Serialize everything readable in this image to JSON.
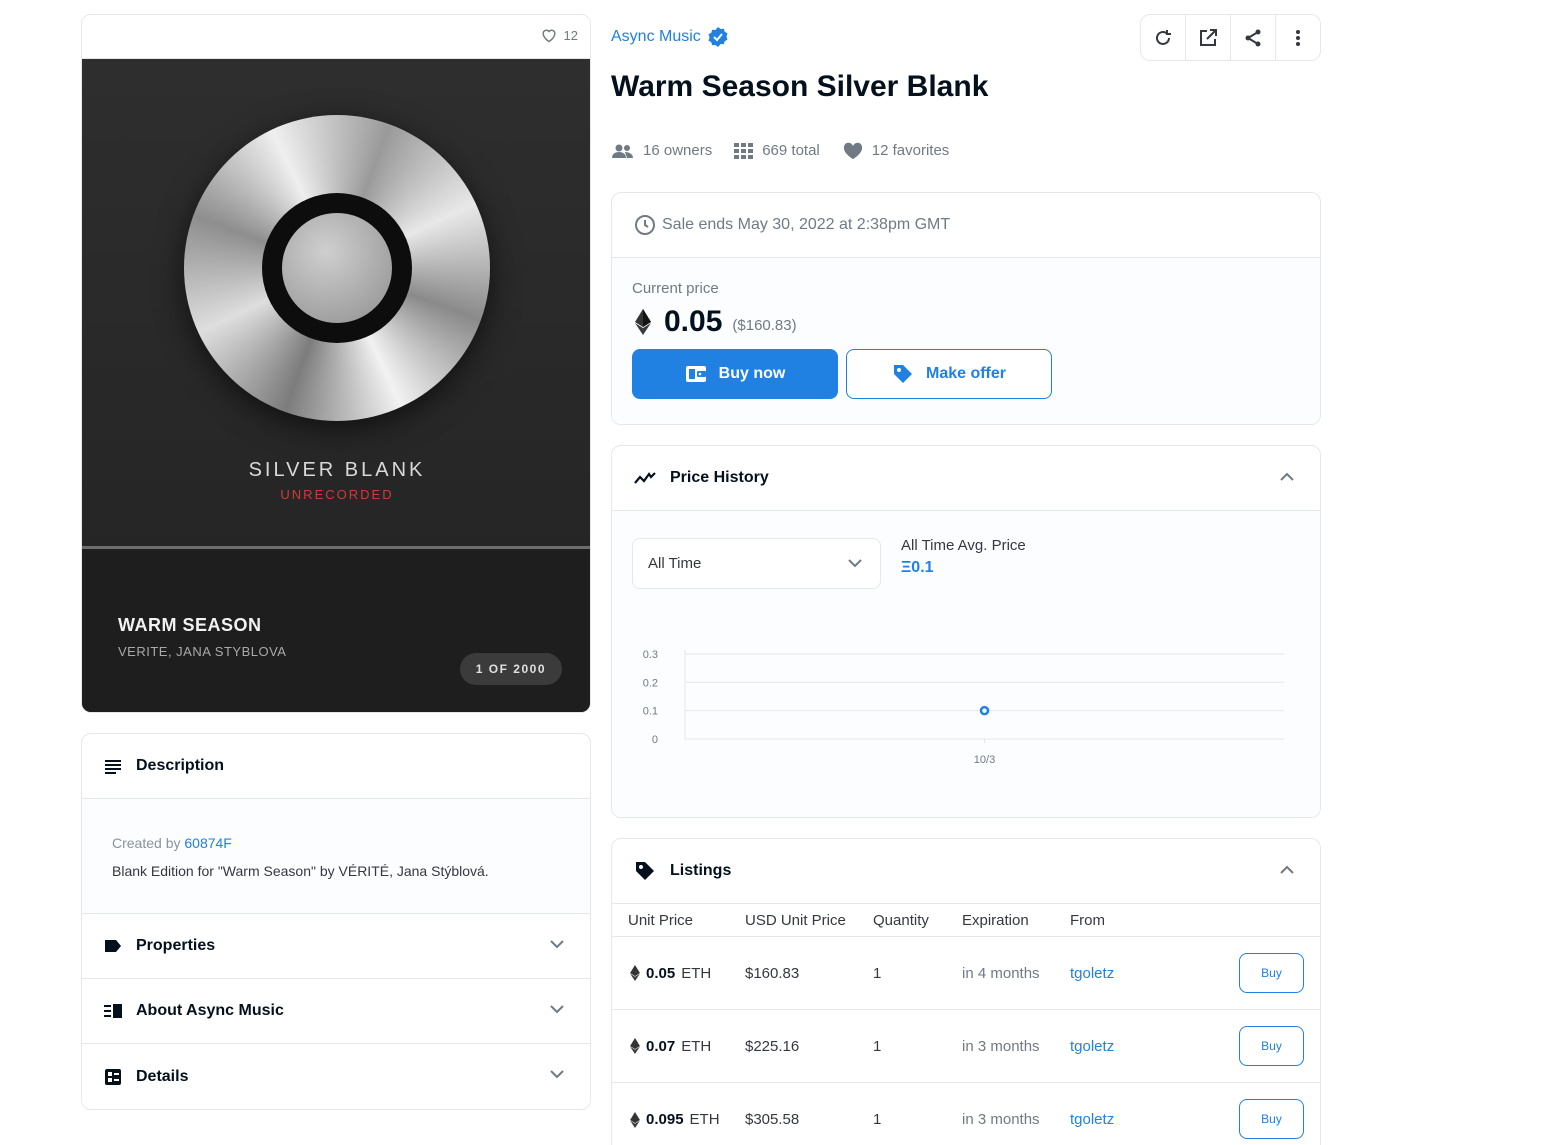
{
  "media": {
    "favorites_count": "12",
    "art_title": "SILVER BLANK",
    "art_subtitle": "UNRECORDED",
    "art_name": "WARM SEASON",
    "art_artists": "VERITE, JANA STYBLOVA",
    "edition": "1 OF 2000"
  },
  "description": {
    "heading": "Description",
    "created_by_label": "Created by",
    "creator": "60874F",
    "text": "Blank Edition for \"Warm Season\" by VÉRITÉ, Jana Stýblová.",
    "sections": [
      {
        "label": "Properties",
        "icon": "tag-icon"
      },
      {
        "label": "About Async Music",
        "icon": "about-icon"
      },
      {
        "label": "Details",
        "icon": "details-icon"
      }
    ]
  },
  "header": {
    "collection": "Async Music",
    "title": "Warm Season Silver Blank",
    "stats": {
      "owners": "16 owners",
      "total": "669 total",
      "favorites": "12 favorites"
    }
  },
  "sale": {
    "ends": "Sale ends May 30, 2022 at 2:38pm GMT",
    "price_label": "Current price",
    "price": "0.05",
    "price_usd": "($160.83)",
    "buy_now": "Buy now",
    "make_offer": "Make offer"
  },
  "price_history": {
    "heading": "Price History",
    "range": "All Time",
    "avg_label": "All Time Avg. Price",
    "avg_value": "Ξ0.1"
  },
  "chart_data": {
    "type": "scatter",
    "x": [
      "10/3"
    ],
    "values": [
      0.1
    ],
    "yticks": [
      "0.3",
      "0.2",
      "0.1",
      "0"
    ],
    "ylim": [
      0,
      0.3
    ],
    "color": "#2081e2"
  },
  "listings": {
    "heading": "Listings",
    "columns": [
      "Unit Price",
      "USD Unit Price",
      "Quantity",
      "Expiration",
      "From"
    ],
    "rows": [
      {
        "price": "0.05",
        "unit": "ETH",
        "usd": "$160.83",
        "qty": "1",
        "exp": "in 4 months",
        "from": "tgoletz",
        "action": "Buy"
      },
      {
        "price": "0.07",
        "unit": "ETH",
        "usd": "$225.16",
        "qty": "1",
        "exp": "in 3 months",
        "from": "tgoletz",
        "action": "Buy"
      },
      {
        "price": "0.095",
        "unit": "ETH",
        "usd": "$305.58",
        "qty": "1",
        "exp": "in 3 months",
        "from": "tgoletz",
        "action": "Buy"
      }
    ]
  },
  "colors": {
    "accent": "#2081e2",
    "text": "#353840",
    "muted": "#707a83"
  }
}
